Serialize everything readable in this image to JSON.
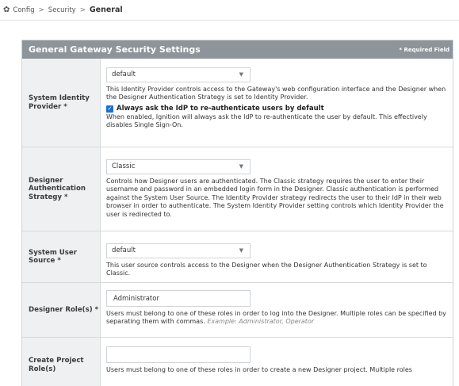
{
  "breadcrumb": {
    "items": [
      "Config",
      "Security"
    ],
    "separator": ">",
    "current": "General"
  },
  "panel": {
    "title": "General Gateway Security Settings",
    "required_note": "* Required Field"
  },
  "rows": {
    "identity_provider": {
      "label": "System Identity Provider *",
      "select_value": "default",
      "description": "This Identity Provider controls access to the Gateway's web configuration interface and the Designer when the Designer Authentication Strategy is set to Identity Provider.",
      "checkbox_label": "Always ask the IdP to re-authenticate users by default",
      "checkbox_checked": true,
      "checkbox_description": "When enabled, Ignition will always ask the IdP to re-authenticate the user by default. This effectively disables Single Sign-On."
    },
    "auth_strategy": {
      "label": "Designer Authentication Strategy *",
      "select_value": "Classic",
      "description": "Controls how Designer users are authenticated. The Classic strategy requires the user to enter their username and password in an embedded login form in the Designer. Classic authentication is performed against the System User Source. The Identity Provider strategy redirects the user to their IdP in their web browser in order to authenticate. The System Identity Provider setting controls which Identity Provider the user is redirected to."
    },
    "user_source": {
      "label": "System User Source *",
      "select_value": "default",
      "description": "This user source controls access to the Designer when the Designer Authentication Strategy is set to Classic."
    },
    "designer_roles": {
      "label": "Designer Role(s) *",
      "input_value": "Administrator",
      "description": "Users must belong to one of these roles in order to log into the Designer. Multiple roles can be specified by separating them with commas.",
      "example": "Example: Administrator, Operator"
    },
    "project_roles": {
      "label": "Create Project Role(s)",
      "input_value": "",
      "description": "Users must belong to one of these roles in order to create a new Designer project. Multiple roles"
    }
  },
  "icons": {
    "gear": "gear-icon",
    "caret": "caret-down-icon",
    "check": "checkmark-icon"
  },
  "colors": {
    "header_bg": "#8d949a",
    "label_bg": "#eef0f1",
    "checkbox": "#1f6fcf"
  }
}
